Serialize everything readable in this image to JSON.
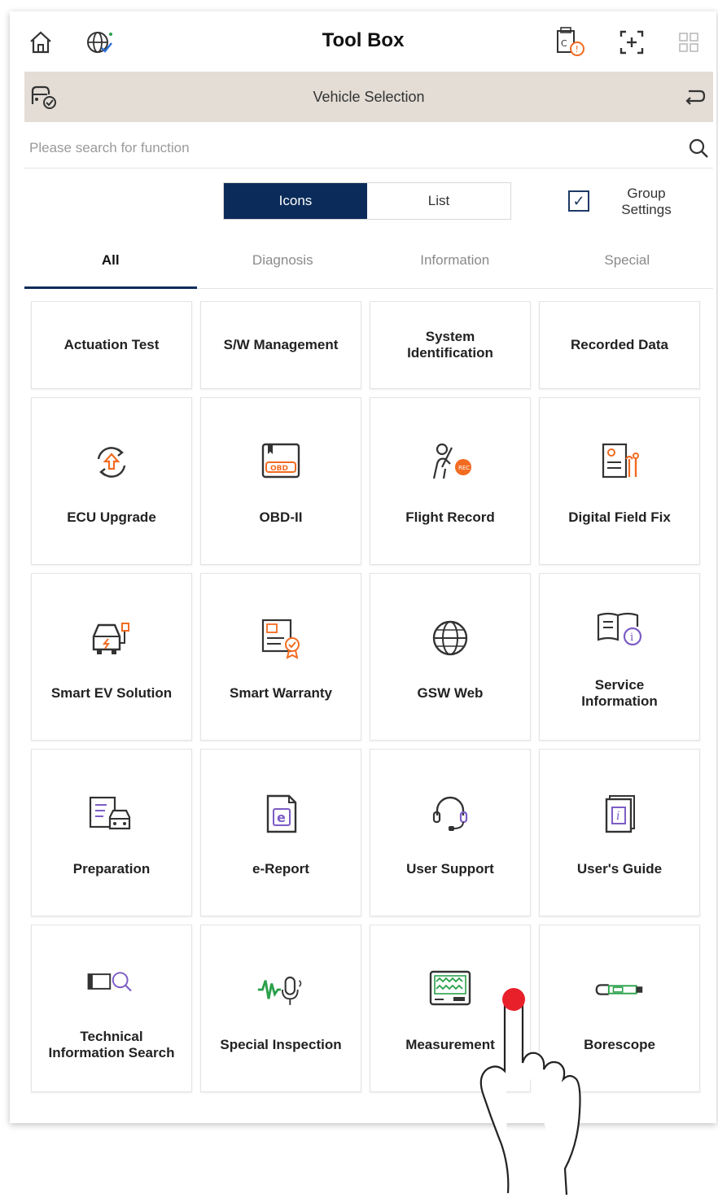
{
  "header": {
    "title": "Tool Box"
  },
  "vehicle_bar": {
    "label": "Vehicle Selection"
  },
  "search": {
    "placeholder": "Please search for function"
  },
  "view_toggle": {
    "icons_label": "Icons",
    "list_label": "List"
  },
  "group_settings": {
    "line1": "Group",
    "line2": "Settings",
    "checked": true
  },
  "tabs": [
    {
      "label": "All",
      "active": true
    },
    {
      "label": "Diagnosis",
      "active": false
    },
    {
      "label": "Information",
      "active": false
    },
    {
      "label": "Special",
      "active": false
    }
  ],
  "quick_cards": [
    {
      "label": "Actuation Test"
    },
    {
      "label": "S/W Management"
    },
    {
      "label": "System\nIdentification"
    },
    {
      "label": "Recorded Data"
    }
  ],
  "tools": [
    {
      "label": "ECU Upgrade",
      "icon": "ecu-upgrade-icon"
    },
    {
      "label": "OBD-II",
      "icon": "obd-icon"
    },
    {
      "label": "Flight Record",
      "icon": "flight-record-icon"
    },
    {
      "label": "Digital Field Fix",
      "icon": "digital-field-fix-icon"
    },
    {
      "label": "Smart EV Solution",
      "icon": "ev-car-icon"
    },
    {
      "label": "Smart Warranty",
      "icon": "warranty-icon"
    },
    {
      "label": "GSW Web",
      "icon": "globe-icon"
    },
    {
      "label": "Service\nInformation",
      "icon": "service-info-icon"
    },
    {
      "label": "Preparation",
      "icon": "preparation-icon"
    },
    {
      "label": "e-Report",
      "icon": "e-report-icon"
    },
    {
      "label": "User Support",
      "icon": "headset-icon"
    },
    {
      "label": "User's Guide",
      "icon": "user-guide-icon"
    },
    {
      "label": "Technical\nInformation Search",
      "icon": "tech-search-icon"
    },
    {
      "label": "Special Inspection",
      "icon": "special-inspection-icon"
    },
    {
      "label": "Measurement",
      "icon": "measurement-icon"
    },
    {
      "label": "Borescope",
      "icon": "borescope-icon"
    }
  ],
  "colors": {
    "accent": "#0b2c5a",
    "orange": "#f26b21",
    "purple": "#7c5cc4",
    "vehicle_bar_bg": "#e3ddd6"
  }
}
